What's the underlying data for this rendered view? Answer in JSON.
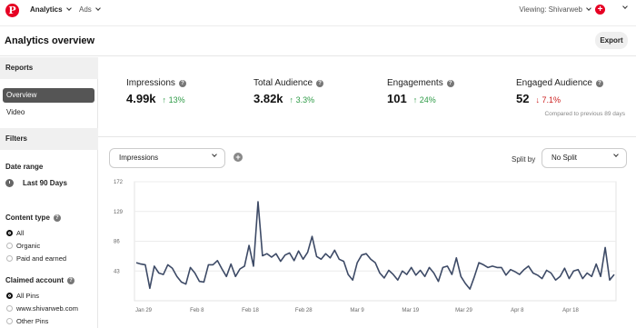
{
  "topbar": {
    "logo": "P",
    "nav": [
      {
        "label": "Analytics"
      },
      {
        "label": "Ads"
      }
    ],
    "viewing": "Viewing: Shivarweb"
  },
  "header": {
    "title": "Analytics overview",
    "export_label": "Export"
  },
  "sidebar": {
    "reports_heading": "Reports",
    "reports": [
      {
        "label": "Overview",
        "active": true
      },
      {
        "label": "Video",
        "active": false
      }
    ],
    "filters_heading": "Filters",
    "date_range_label": "Date range",
    "date_range_value": "Last 90 Days",
    "content_type_label": "Content type",
    "content_types": [
      {
        "label": "All",
        "selected": true
      },
      {
        "label": "Organic",
        "selected": false
      },
      {
        "label": "Paid and earned",
        "selected": false
      }
    ],
    "claimed_account_label": "Claimed account",
    "claimed_accounts": [
      {
        "label": "All Pins",
        "selected": true
      },
      {
        "label": "www.shivarweb.com",
        "selected": false
      },
      {
        "label": "Other Pins",
        "selected": false
      }
    ]
  },
  "metrics": [
    {
      "label": "Impressions",
      "value": "4.99k",
      "delta": "13%",
      "direction": "up"
    },
    {
      "label": "Total Audience",
      "value": "3.82k",
      "delta": "3.3%",
      "direction": "up"
    },
    {
      "label": "Engagements",
      "value": "101",
      "delta": "24%",
      "direction": "up"
    },
    {
      "label": "Engaged Audience",
      "value": "52",
      "delta": "7.1%",
      "direction": "down"
    }
  ],
  "compared_note": "Compared to previous 89 days",
  "controls": {
    "metric_select": "Impressions",
    "split_label": "Split by",
    "split_select": "No Split"
  },
  "colors": {
    "brand": "#e60023",
    "line": "#3d4a66",
    "up": "#2e9b47",
    "down": "#cc1f1f"
  },
  "chart_data": {
    "type": "line",
    "ylim": [
      0,
      172
    ],
    "yticks": [
      43,
      86,
      129,
      172
    ],
    "xticks": [
      "Jan 29",
      "Feb 8",
      "Feb 18",
      "Feb 28",
      "Mar 9",
      "Mar 19",
      "Mar 29",
      "Apr 8",
      "Apr 18"
    ],
    "series": [
      {
        "values": [
          55,
          53,
          52,
          18,
          50,
          40,
          38,
          52,
          47,
          35,
          27,
          24,
          48,
          40,
          28,
          27,
          52,
          52,
          58,
          46,
          35,
          53,
          35,
          46,
          50,
          80,
          50,
          143,
          65,
          68,
          63,
          68,
          57,
          66,
          69,
          58,
          72,
          60,
          70,
          93,
          64,
          60,
          68,
          62,
          73,
          60,
          57,
          38,
          30,
          55,
          66,
          68,
          60,
          55,
          40,
          33,
          44,
          38,
          30,
          43,
          38,
          48,
          37,
          44,
          35,
          48,
          40,
          28,
          48,
          50,
          38,
          62,
          35,
          25,
          17,
          35,
          55,
          52,
          48,
          50,
          48,
          48,
          37,
          45,
          42,
          38,
          45,
          50,
          40,
          37,
          32,
          44,
          40,
          30,
          35,
          47,
          32,
          43,
          45,
          32,
          40,
          35,
          53,
          35,
          77,
          30,
          38
        ]
      }
    ]
  }
}
